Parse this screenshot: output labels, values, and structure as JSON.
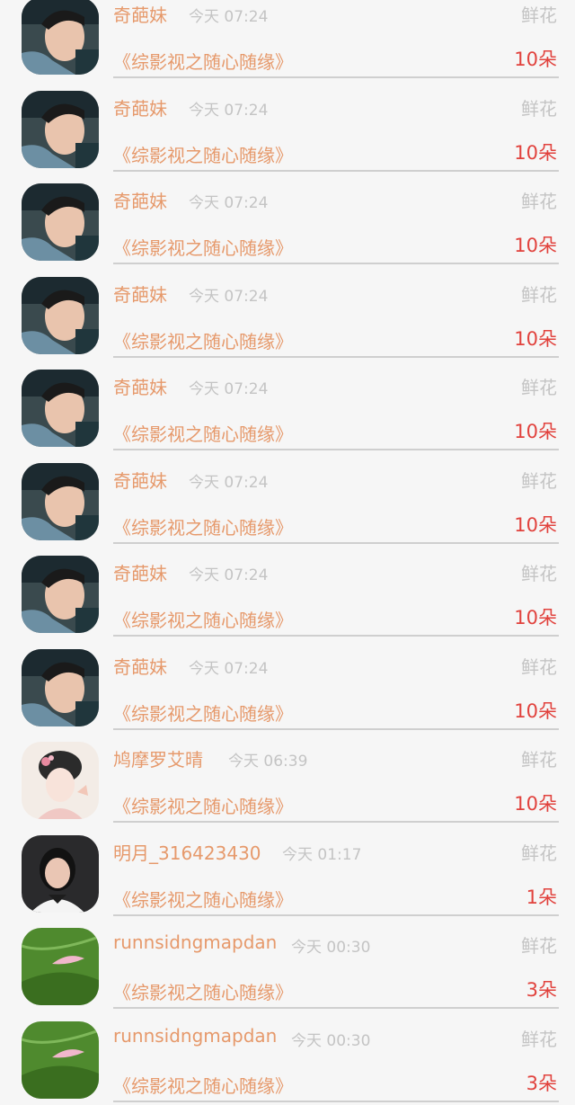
{
  "rows": [
    {
      "name": "奇葩妹",
      "time": "今天 07:24",
      "type": "鲜花",
      "book": "《综影视之随心随缘》",
      "count": "10朵",
      "avatar": "actor-avatar"
    },
    {
      "name": "奇葩妹",
      "time": "今天 07:24",
      "type": "鲜花",
      "book": "《综影视之随心随缘》",
      "count": "10朵",
      "avatar": "actor-avatar"
    },
    {
      "name": "奇葩妹",
      "time": "今天 07:24",
      "type": "鲜花",
      "book": "《综影视之随心随缘》",
      "count": "10朵",
      "avatar": "actor-avatar"
    },
    {
      "name": "奇葩妹",
      "time": "今天 07:24",
      "type": "鲜花",
      "book": "《综影视之随心随缘》",
      "count": "10朵",
      "avatar": "actor-avatar"
    },
    {
      "name": "奇葩妹",
      "time": "今天 07:24",
      "type": "鲜花",
      "book": "《综影视之随心随缘》",
      "count": "10朵",
      "avatar": "actor-avatar"
    },
    {
      "name": "奇葩妹",
      "time": "今天 07:24",
      "type": "鲜花",
      "book": "《综影视之随心随缘》",
      "count": "10朵",
      "avatar": "actor-avatar"
    },
    {
      "name": "奇葩妹",
      "time": "今天 07:24",
      "type": "鲜花",
      "book": "《综影视之随心随缘》",
      "count": "10朵",
      "avatar": "actor-avatar"
    },
    {
      "name": "奇葩妹",
      "time": "今天 07:24",
      "type": "鲜花",
      "book": "《综影视之随心随缘》",
      "count": "10朵",
      "avatar": "actor-avatar"
    },
    {
      "name": "鸠摩罗艾晴",
      "time": "今天 06:39",
      "type": "鲜花",
      "book": "《综影视之随心随缘》",
      "count": "10朵",
      "avatar": "illustration-avatar"
    },
    {
      "name": "明月_316423430",
      "time": "今天 01:17",
      "type": "鲜花",
      "book": "《综影视之随心随缘》",
      "count": "1朵",
      "avatar": "girl-avatar"
    },
    {
      "name": "runnsidngmapdan",
      "time": "今天 00:30",
      "type": "鲜花",
      "book": "《综影视之随心随缘》",
      "count": "3朵",
      "avatar": "leaf-avatar"
    },
    {
      "name": "runnsidngmapdan",
      "time": "今天 00:30",
      "type": "鲜花",
      "book": "《综影视之随心随缘》",
      "count": "3朵",
      "avatar": "leaf-avatar"
    }
  ]
}
